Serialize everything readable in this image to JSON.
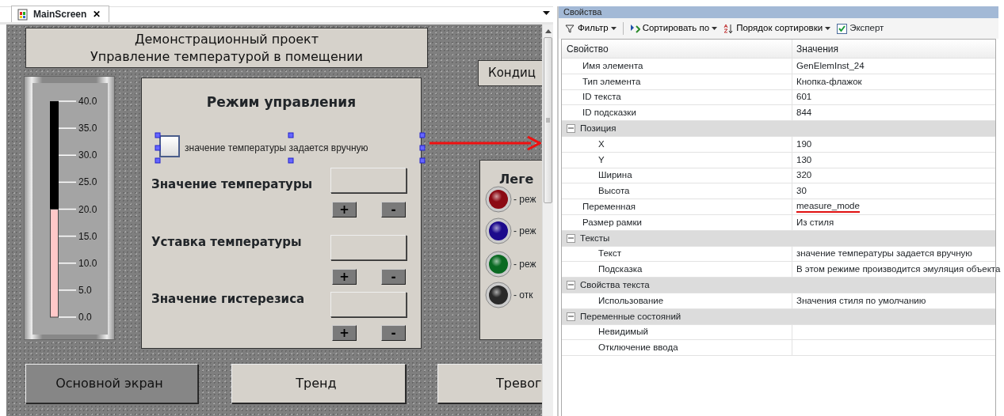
{
  "editor_tab": {
    "title": "MainScreen",
    "close": "✕"
  },
  "canvas": {
    "header": [
      "Демонстрационный проект",
      "Управление температурой в помещении"
    ],
    "gauge": {
      "level": 0.5,
      "ticks": [
        "40.0",
        "35.0",
        "30.0",
        "25.0",
        "20.0",
        "15.0",
        "10.0",
        "5.0",
        "0.0"
      ]
    },
    "control_panel": {
      "title": "Режим управления",
      "checkbox": {
        "label": "значение температуры задается вручную",
        "checked": false,
        "selected": true
      },
      "fields": [
        {
          "label": "Значение температуры",
          "buttons": [
            "+",
            "-"
          ]
        },
        {
          "label": "Уставка температуры",
          "buttons": [
            "+",
            "-"
          ]
        },
        {
          "label": "Значение гистерезиса",
          "buttons": [
            "+",
            "-"
          ]
        }
      ]
    },
    "side_button": "Кондиц",
    "legend": {
      "title": "Леге",
      "items": [
        {
          "label": "- реж",
          "color": "#8c0a14"
        },
        {
          "label": "- реж",
          "color": "#1c0a8c"
        },
        {
          "label": "- реж",
          "color": "#0a6a22"
        },
        {
          "label": "- отк",
          "color": "#2a2a2a"
        }
      ]
    },
    "nav_buttons": [
      {
        "label": "Основной экран",
        "selected": true
      },
      {
        "label": "Тренд",
        "selected": false
      },
      {
        "label": "Тревог",
        "selected": false
      }
    ]
  },
  "properties": {
    "title": "Свойства",
    "toolbar": [
      {
        "kind": "dropdown",
        "label": "Фильтр"
      },
      {
        "kind": "dropdown",
        "label": "Сортировать по"
      },
      {
        "kind": "dropdown",
        "label": "Порядок сортировки"
      },
      {
        "kind": "checkbox",
        "label": "Эксперт",
        "checked": true
      }
    ],
    "columns": [
      "Свойство",
      "Значения"
    ],
    "rows": [
      {
        "kind": "property",
        "name": "Имя элемента",
        "value": "GenElemInst_24"
      },
      {
        "kind": "property",
        "name": "Тип элемента",
        "value": "Кнопка-флажок"
      },
      {
        "kind": "property",
        "name": "ID текста",
        "value": "601"
      },
      {
        "kind": "property",
        "name": "ID подсказки",
        "value": "844"
      },
      {
        "kind": "group",
        "name": "Позиция",
        "expanded": true,
        "children": [
          {
            "kind": "property",
            "name": "X",
            "value": "190"
          },
          {
            "kind": "property",
            "name": "Y",
            "value": "130"
          },
          {
            "kind": "property",
            "name": "Ширина",
            "value": "320"
          },
          {
            "kind": "property",
            "name": "Высота",
            "value": "30"
          }
        ]
      },
      {
        "kind": "property",
        "name": "Переменная",
        "value": "measure_mode",
        "highlighted": true
      },
      {
        "kind": "property",
        "name": "Размер рамки",
        "value": "Из стиля"
      },
      {
        "kind": "group",
        "name": "Тексты",
        "expanded": true,
        "children": [
          {
            "kind": "property",
            "name": "Текст",
            "value": "значение температуры задается вручную"
          },
          {
            "kind": "property",
            "name": "Подсказка",
            "value": "В этом режиме производится эмуляция объекта"
          }
        ]
      },
      {
        "kind": "group",
        "name": "Свойства текста",
        "expanded": true,
        "children": [
          {
            "kind": "property",
            "name": "Использование",
            "value": "Значения стиля по умолчанию"
          }
        ]
      },
      {
        "kind": "group",
        "name": "Переменные состояний",
        "expanded": true,
        "children": [
          {
            "kind": "property",
            "name": "Невидимый"
          },
          {
            "kind": "property",
            "name": "Отключение ввода"
          }
        ]
      }
    ]
  }
}
